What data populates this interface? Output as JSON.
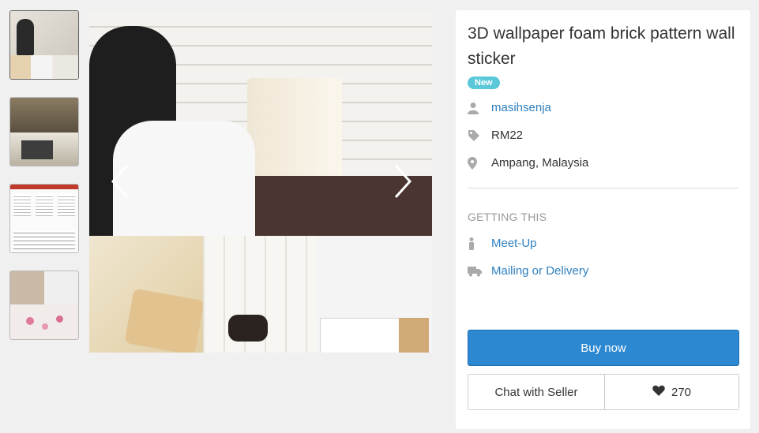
{
  "listing": {
    "title": "3D wallpaper foam brick pattern wall sticker",
    "badge": "New",
    "seller": "masihsenja",
    "price": "RM22",
    "location": "Ampang, Malaysia"
  },
  "getting": {
    "label": "GETTING THIS",
    "meetup": "Meet-Up",
    "delivery": "Mailing or Delivery"
  },
  "actions": {
    "buy": "Buy now",
    "chat": "Chat with Seller",
    "likes": "270"
  },
  "colors": {
    "accent": "#2d88d2",
    "link": "#2d7fc0",
    "badge": "#5ac8d8"
  },
  "icons": [
    "chevron-left-icon",
    "chevron-right-icon",
    "user-icon",
    "tag-icon",
    "location-pin-icon",
    "person-icon",
    "truck-icon",
    "heart-icon"
  ]
}
